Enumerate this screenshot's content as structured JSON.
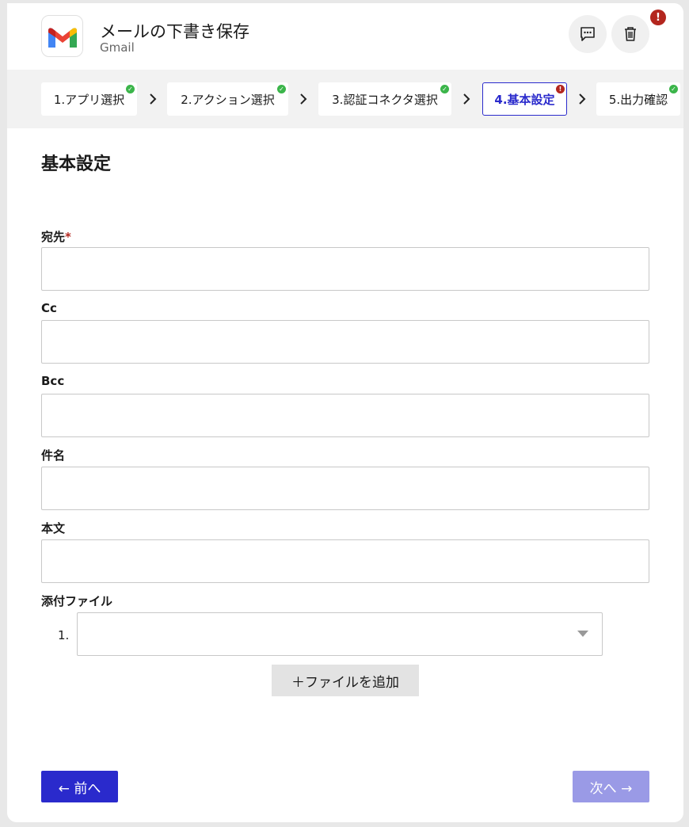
{
  "header": {
    "title": "メールの下書き保存",
    "subtitle": "Gmail",
    "alert_badge": "!"
  },
  "steps": [
    {
      "label": "1.アプリ選択",
      "status": "ok"
    },
    {
      "label": "2.アクション選択",
      "status": "ok"
    },
    {
      "label": "3.認証コネクタ選択",
      "status": "ok"
    },
    {
      "label": "4.基本設定",
      "status": "error"
    },
    {
      "label": "5.出力確認",
      "status": "ok"
    }
  ],
  "form": {
    "section_title": "基本設定",
    "to_label": "宛先",
    "required_mark": "*",
    "to_value": "",
    "cc_label": "Cc",
    "cc_value": "",
    "bcc_label": "Bcc",
    "bcc_value": "",
    "subject_label": "件名",
    "subject_value": "",
    "body_label": "本文",
    "body_value": "",
    "attachments_label": "添付ファイル",
    "attachment_item_number": "1.",
    "add_attachment_button": "＋ファイルを追加"
  },
  "footer": {
    "prev_button": "← 前へ",
    "next_button": "次へ →"
  },
  "colors": {
    "primary": "#2a2acc",
    "primary_disabled": "#9a9ae6",
    "success": "#3bb54a",
    "error": "#b3261e"
  }
}
